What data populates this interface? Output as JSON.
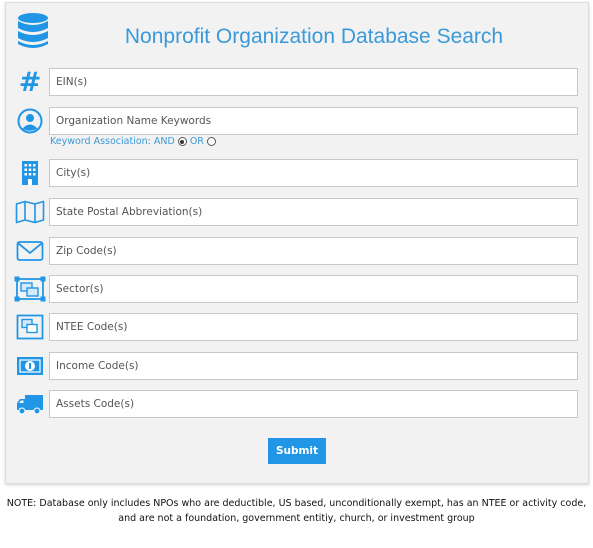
{
  "header": {
    "title": "Nonprofit Organization Database Search",
    "icon": "database-icon"
  },
  "fields": [
    {
      "name": "ein",
      "icon": "hash-icon",
      "placeholder": "EIN(s)",
      "value": ""
    },
    {
      "name": "org-name",
      "icon": "user-circle-icon",
      "placeholder": "Organization Name Keywords",
      "value": ""
    },
    {
      "name": "city",
      "icon": "building-icon",
      "placeholder": "City(s)",
      "value": ""
    },
    {
      "name": "state",
      "icon": "map-icon",
      "placeholder": "State Postal Abbreviation(s)",
      "value": ""
    },
    {
      "name": "zip",
      "icon": "envelope-icon",
      "placeholder": "Zip Code(s)",
      "value": ""
    },
    {
      "name": "sector",
      "icon": "object-group-icon",
      "placeholder": "Sector(s)",
      "value": ""
    },
    {
      "name": "ntee",
      "icon": "clone-icon",
      "placeholder": "NTEE Code(s)",
      "value": ""
    },
    {
      "name": "income",
      "icon": "money-icon",
      "placeholder": "Income Code(s)",
      "value": ""
    },
    {
      "name": "assets",
      "icon": "truck-icon",
      "placeholder": "Assets Code(s)",
      "value": ""
    }
  ],
  "keyword_association": {
    "label": "Keyword Association:",
    "option_and": "AND",
    "option_or": "OR",
    "selected": "AND"
  },
  "submit_label": "Submit",
  "note": "NOTE: Database only includes NPOs who are deductible, US based, unconditionally exempt, has an NTEE or activity code, and are not a foundation, government entitiy, church, or investment group",
  "colors": {
    "accent": "#2196e6",
    "title": "#3a9ad9",
    "panel_bg": "#f2f2f2"
  }
}
